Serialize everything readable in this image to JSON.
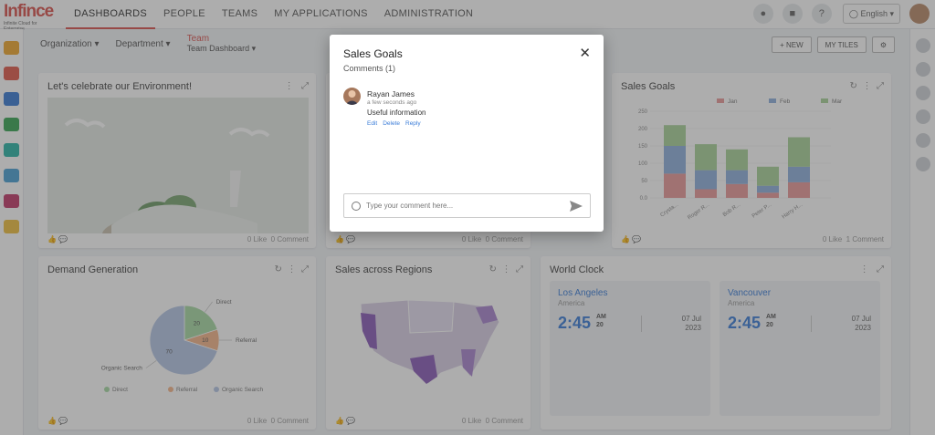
{
  "logo": {
    "text": "Infince",
    "sub": "Infinite Cloud for Enterprise"
  },
  "nav": [
    "DASHBOARDS",
    "PEOPLE",
    "TEAMS",
    "MY APPLICATIONS",
    "ADMINISTRATION"
  ],
  "topbar": {
    "language": "English"
  },
  "filters": {
    "organization": "Organization",
    "department": "Department",
    "team": "Team",
    "team_value": "Team Dashboard"
  },
  "buttons": {
    "new": "+ NEW",
    "my_tiles": "MY TILES"
  },
  "tiles": {
    "environment": {
      "title": "Let's celebrate our Environment!",
      "likes": "0 Like",
      "comments": "0 Comment"
    },
    "hidden_mid": {
      "likes": "0 Like",
      "comments": "0 Comment"
    },
    "sales_goals": {
      "title": "Sales Goals",
      "likes": "0 Like",
      "comments": "1 Comment"
    },
    "demand": {
      "title": "Demand Generation",
      "likes": "0 Like",
      "comments": "0 Comment"
    },
    "regions": {
      "title": "Sales across Regions",
      "likes": "0 Like",
      "comments": "0 Comment"
    },
    "world_clock": {
      "title": "World Clock"
    }
  },
  "sales_chart": {
    "type": "bar",
    "categories": [
      "Crysta...",
      "Roger R...",
      "Bob R...",
      "Peter P...",
      "Harry H..."
    ],
    "series": [
      {
        "name": "Jan",
        "values": [
          70,
          25,
          40,
          15,
          45
        ]
      },
      {
        "name": "Feb",
        "values": [
          80,
          55,
          40,
          20,
          45
        ]
      },
      {
        "name": "Mar",
        "values": [
          60,
          75,
          60,
          55,
          85
        ]
      }
    ],
    "ylim": [
      0,
      250
    ],
    "yticks": [
      "250",
      "200",
      "150",
      "100",
      "50",
      "0.0"
    ]
  },
  "demand_chart": {
    "type": "pie",
    "slices": [
      {
        "name": "Direct",
        "value": 20
      },
      {
        "name": "Referral",
        "value": 10
      },
      {
        "name": "Organic Search",
        "value": 70
      }
    ]
  },
  "clocks": [
    {
      "city": "Los Angeles",
      "region": "America",
      "time": "2:45",
      "ampm": "AM",
      "sec": "20",
      "day": "07 Jul",
      "year": "2023"
    },
    {
      "city": "Vancouver",
      "region": "America",
      "time": "2:45",
      "ampm": "AM",
      "sec": "20",
      "day": "07 Jul",
      "year": "2023"
    }
  ],
  "modal": {
    "title": "Sales Goals",
    "subtitle": "Comments (1)",
    "comment": {
      "author": "Rayan James",
      "time": "a few seconds ago",
      "text": "Useful information",
      "actions": [
        "Edit",
        "Delete",
        "Reply"
      ]
    },
    "input_placeholder": "Type your comment here..."
  },
  "colors": {
    "accent": "#d9534f",
    "link": "#3b7dd8",
    "jan": "#e99a9a",
    "feb": "#8fb0dd",
    "mar": "#a9d39a"
  }
}
